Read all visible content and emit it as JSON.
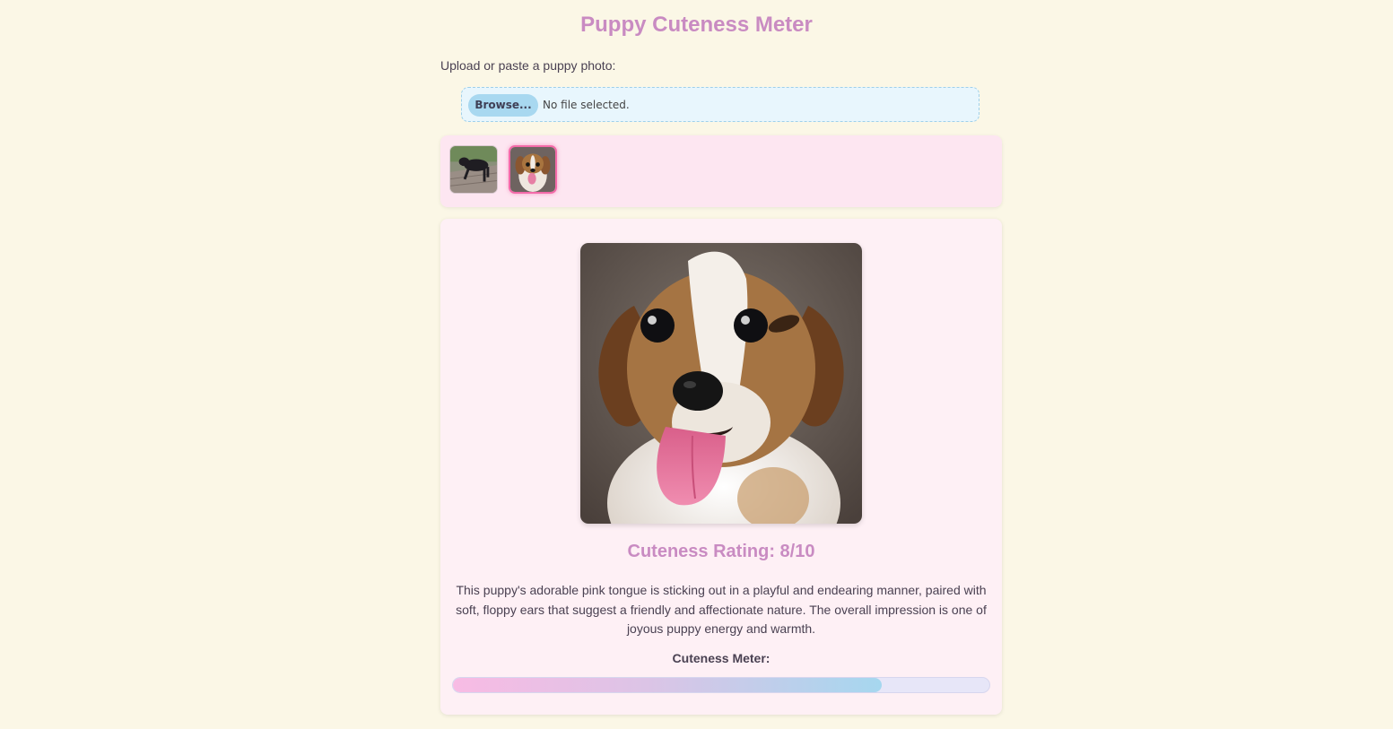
{
  "page": {
    "title": "Puppy Cuteness Meter",
    "upload_label": "Upload or paste a puppy photo:"
  },
  "file_input": {
    "button_label": "Browse...",
    "status": "No file selected."
  },
  "thumbnails": [
    {
      "name": "black-dog-thumbnail",
      "selected": false
    },
    {
      "name": "tongue-puppy-thumbnail",
      "selected": true
    }
  ],
  "result": {
    "rating_text": "Cuteness Rating: 8/10",
    "rating_value": 8,
    "rating_max": 10,
    "description": "This puppy's adorable pink tongue is sticking out in a playful and endearing manner, paired with soft, floppy ears that suggest a friendly and affectionate nature. The overall impression is one of joyous puppy energy and warmth.",
    "meter_label": "Cuteness Meter:",
    "meter_fraction": 0.8
  },
  "colors": {
    "background": "#fbf7e6",
    "accent": "#c98bc2",
    "selected_border": "#f36aa8"
  }
}
